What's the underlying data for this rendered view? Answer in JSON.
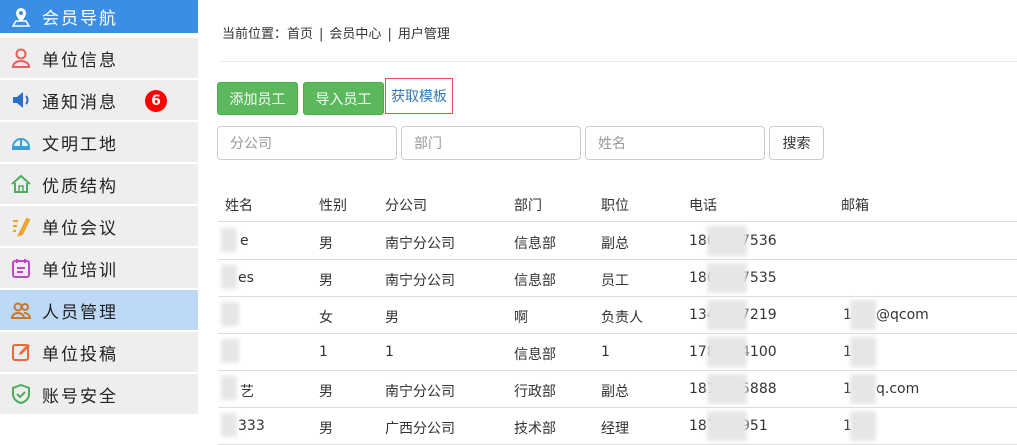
{
  "sidebar": {
    "items": [
      {
        "label": "会员导航",
        "icon": "map-pin-icon"
      },
      {
        "label": "单位信息",
        "icon": "user-icon"
      },
      {
        "label": "通知消息",
        "icon": "speaker-icon",
        "badge": "6"
      },
      {
        "label": "文明工地",
        "icon": "helmet-icon"
      },
      {
        "label": "优质结构",
        "icon": "home-icon"
      },
      {
        "label": "单位会议",
        "icon": "meeting-icon"
      },
      {
        "label": "单位培训",
        "icon": "training-icon"
      },
      {
        "label": "人员管理",
        "icon": "people-icon"
      },
      {
        "label": "单位投稿",
        "icon": "edit-icon"
      },
      {
        "label": "账号安全",
        "icon": "shield-icon"
      }
    ]
  },
  "breadcrumb": {
    "prefix": "当前位置：",
    "items": [
      "首页",
      "会员中心",
      "用户管理"
    ],
    "separator": "|"
  },
  "toolbar": {
    "add_label": "添加员工",
    "import_label": "导入员工",
    "template_label": "获取模板"
  },
  "filters": {
    "company_placeholder": "分公司",
    "dept_placeholder": "部门",
    "name_placeholder": "姓名",
    "search_label": "搜索"
  },
  "table": {
    "headers": [
      "姓名",
      "性别",
      "分公司",
      "部门",
      "职位",
      "电话",
      "邮箱"
    ],
    "rows": [
      [
        "e",
        "男",
        "南宁分公司",
        "信息部",
        "副总",
        "180",
        "7536",
        "",
        ""
      ],
      [
        "es",
        "男",
        "南宁分公司",
        "信息部",
        "员工",
        "180",
        "7535",
        "",
        ""
      ],
      [
        "",
        "女",
        "男",
        "啊",
        "负责人",
        "134",
        "7219",
        "1",
        "@qcom"
      ],
      [
        "",
        "1",
        "1",
        "信息部",
        "1",
        "178",
        "4100",
        "1",
        ""
      ],
      [
        "艺",
        "男",
        "南宁分公司",
        "行政部",
        "副总",
        "1817",
        "5888",
        "1",
        "q.com"
      ],
      [
        "333",
        "男",
        "广西分公司",
        "技术部",
        "经理",
        "1877",
        "951",
        "1",
        ""
      ]
    ]
  },
  "colors": {
    "header_blue": "#3a8ee6",
    "active_blue": "#bdd9f5",
    "green": "#5cb85c",
    "badge_red": "#ff0000"
  }
}
